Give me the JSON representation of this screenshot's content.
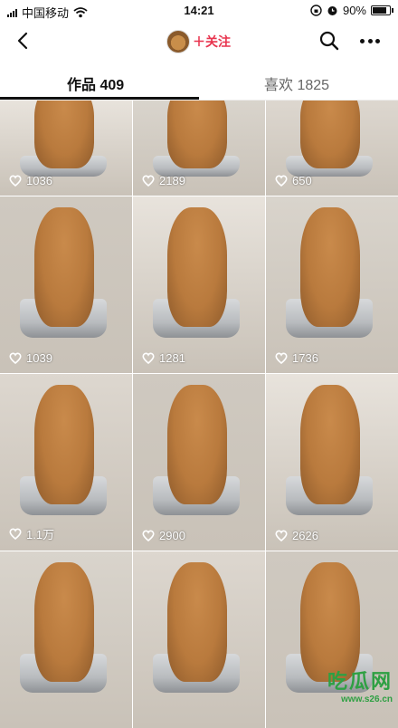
{
  "status_bar": {
    "carrier": "中国移动",
    "time": "14:21",
    "battery": "90%",
    "battery_level": 0.9
  },
  "nav": {
    "follow_label": "＋关注"
  },
  "tabs": [
    {
      "label": "作品 409",
      "active": true
    },
    {
      "label": "喜欢 1825",
      "active": false
    }
  ],
  "videos": [
    {
      "likes": "1036"
    },
    {
      "likes": "2189"
    },
    {
      "likes": "650"
    },
    {
      "likes": "1039"
    },
    {
      "likes": "1281"
    },
    {
      "likes": "1736"
    },
    {
      "likes": "1.1万"
    },
    {
      "likes": "2900"
    },
    {
      "likes": "2626"
    },
    {
      "likes": ""
    },
    {
      "likes": ""
    },
    {
      "likes": ""
    }
  ],
  "watermark": {
    "brand": "吃瓜网",
    "url": "www.s26.cn"
  },
  "colors": {
    "accent": "#e8344e",
    "dog": "#b97a3d",
    "pot": "#b9bcbf"
  }
}
